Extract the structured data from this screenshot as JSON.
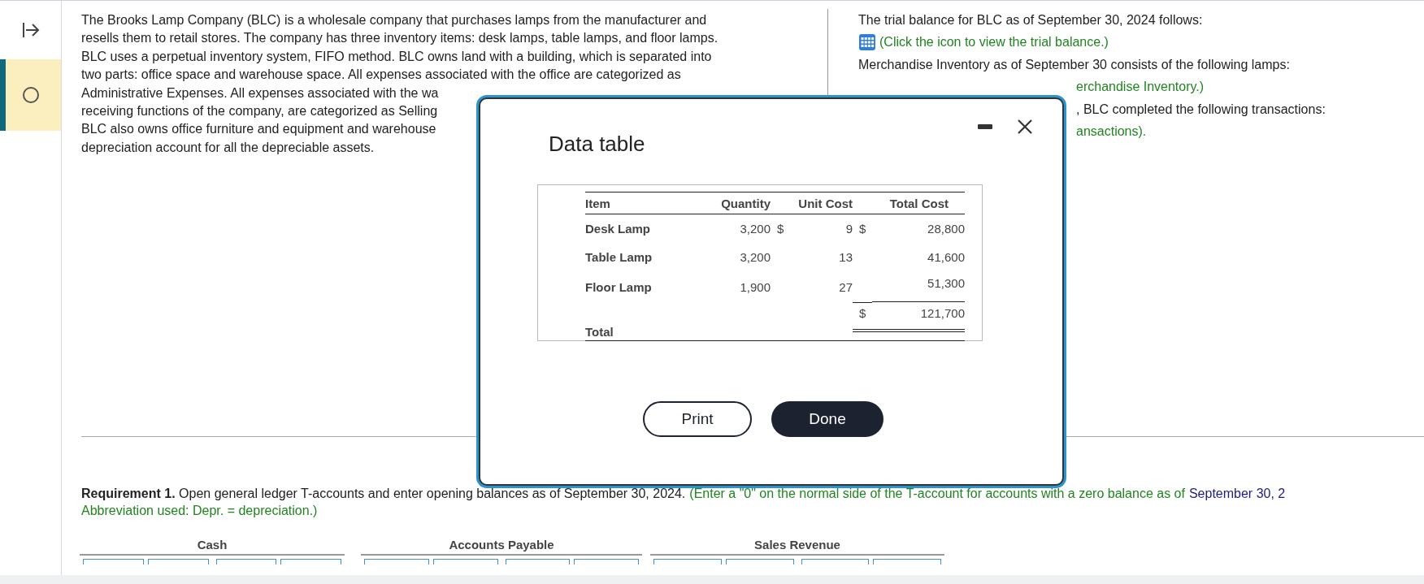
{
  "sidebar": {
    "toggle": {
      "kind": "expand"
    },
    "steps": [
      {
        "selected": true
      }
    ]
  },
  "intro": {
    "lines": [
      "The Brooks Lamp Company (BLC) is a wholesale company that purchases lamps from the manufacturer and",
      "resells them to retail stores. The company has three inventory items: desk lamps, table lamps, and floor lamps.",
      "BLC uses a perpetual inventory system, FIFO method. BLC owns land with a building, which is separated into",
      "two parts: office space and warehouse space. All expenses associated with the office are categorized as",
      "Administrative Expenses. All expenses associated with the wa",
      "receiving functions of the company, are categorized as Selling",
      "BLC also owns office furniture and equipment and warehouse",
      "depreciation account for all the depreciable assets."
    ]
  },
  "facts": [
    {
      "kind": "text",
      "text": "The trial balance for BLC as of September 30, 2024 follows:",
      "cut": false
    },
    {
      "kind": "link",
      "text": "(Click the icon to view the trial balance.)",
      "cut": false
    },
    {
      "kind": "text",
      "text": "Merchandise Inventory as of September 30 consists of the following lamps:",
      "cut": false
    },
    {
      "kind": "link",
      "text": "erchandise Inventory.)",
      "cut": true
    },
    {
      "kind": "text",
      "text": ", BLC completed the following transactions:",
      "cut": true
    },
    {
      "kind": "link",
      "text": "ansactions).",
      "cut": true
    }
  ],
  "requirement": {
    "text": "**Requirement 1.** Open general ledger T-accounts and enter opening balances as of September 30, 2024.",
    "hint": "(Enter a \"0\" on the normal side of the T-account for accounts with a zero balance as of",
    "hint_date": "September 30, 2",
    "abbreviation": "Abbreviation used: Depr. = depreciation.)"
  },
  "t_accounts": [
    {
      "title": "Cash"
    },
    {
      "title": "Accounts Payable"
    },
    {
      "title": "Sales Revenue"
    }
  ],
  "modal": {
    "title": "Data table",
    "columns": [
      "Item",
      "Quantity",
      "Unit Cost",
      "Total Cost"
    ],
    "rows": [
      {
        "item": "Desk Lamp",
        "quantity": "3,200",
        "unit_currency": "$",
        "unit_cost": "9",
        "total_currency": "$",
        "total_cost": "28,800"
      },
      {
        "item": "Table Lamp",
        "quantity": "3,200",
        "unit_cost": "13",
        "total_cost": "41,600"
      },
      {
        "item": "Floor Lamp",
        "quantity": "1,900",
        "unit_cost": "27",
        "total_cost": "51,300"
      }
    ],
    "total": {
      "label": "Total",
      "currency": "$",
      "amount": "121,700"
    },
    "buttons": [
      {
        "label": "Print",
        "kind": "secondary"
      },
      {
        "label": "Done",
        "kind": "primary"
      }
    ]
  }
}
